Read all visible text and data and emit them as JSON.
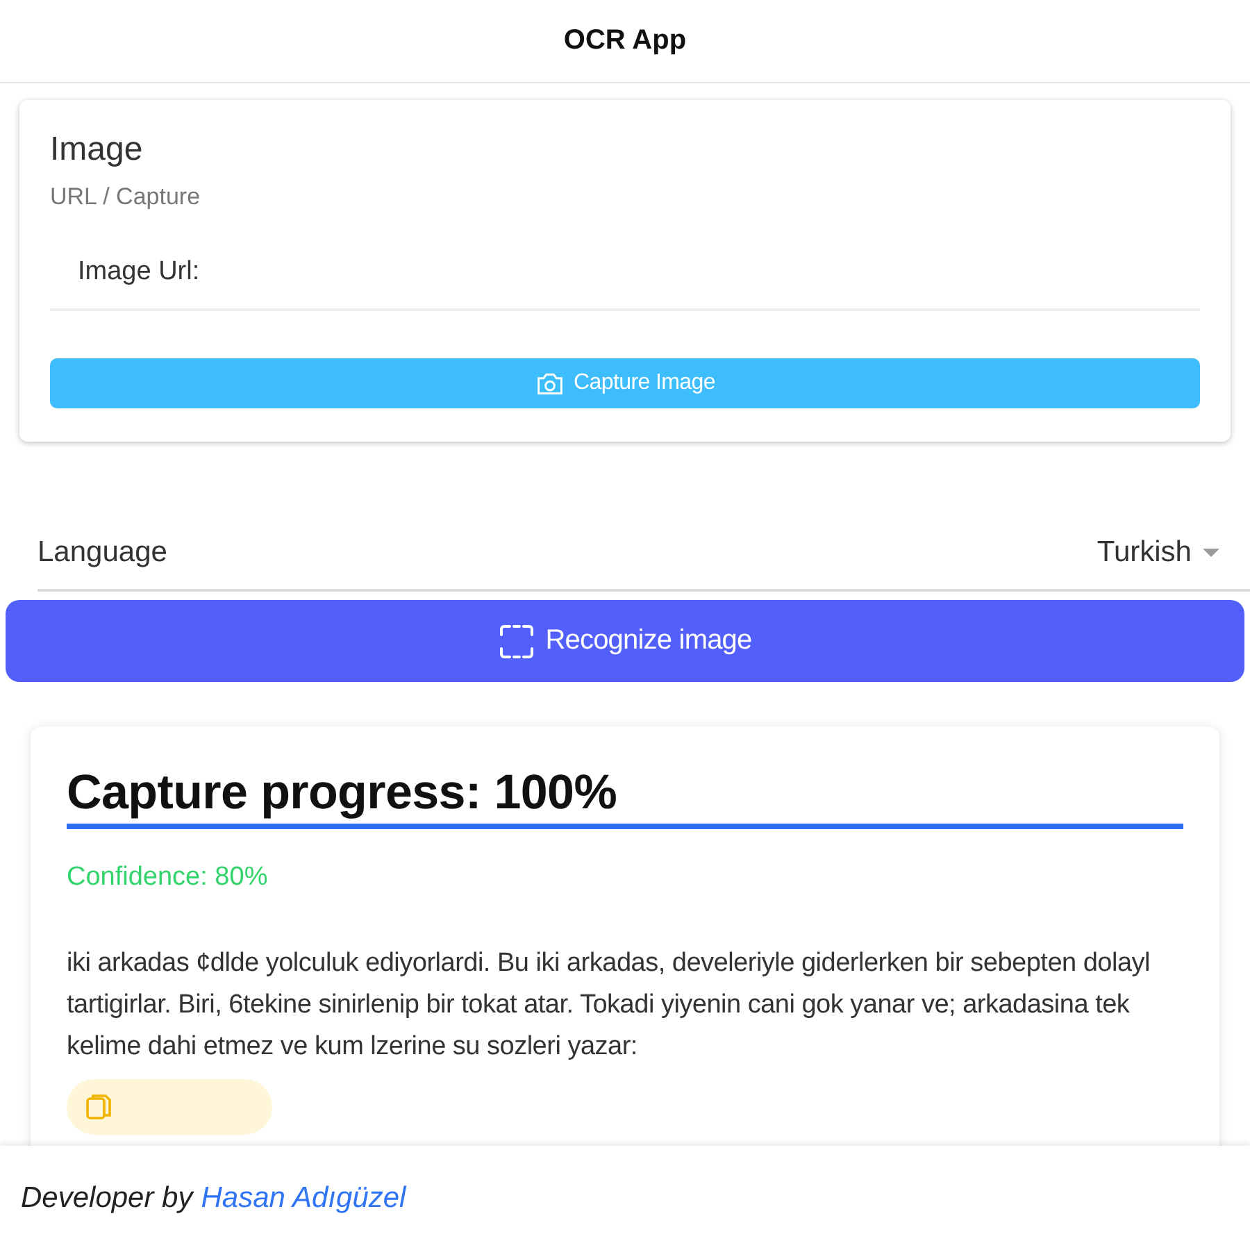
{
  "app_bar": {
    "title": "OCR App"
  },
  "image_card": {
    "title": "Image",
    "subtitle": "URL / Capture",
    "url_field": {
      "label": "Image Url:"
    },
    "capture_button": {
      "label": "Capture Image"
    }
  },
  "language": {
    "label": "Language",
    "value": "Turkish"
  },
  "recognize_button": {
    "label": "Recognize image"
  },
  "result_card": {
    "progress_title": "Capture progress: 100%",
    "progress": {
      "level": 1.0
    },
    "confidence": "Confidence: 80%",
    "text": "iki arkadas ¢dlde yolculuk ediyorlardi. Bu iki arkadas, develeriyle giderlerken bir sebepten dolayl tartigirlar. Biri, 6tekine sinirlenip bir tokat atar. Tokadi yiyenin cani gok yanar ve; arkadasina tek kelime dahi etmez ve kum lzerine su sozleri yazar:"
  },
  "footer": {
    "prefix": "Developer by",
    "link": "Hasan Adıgüzel"
  }
}
